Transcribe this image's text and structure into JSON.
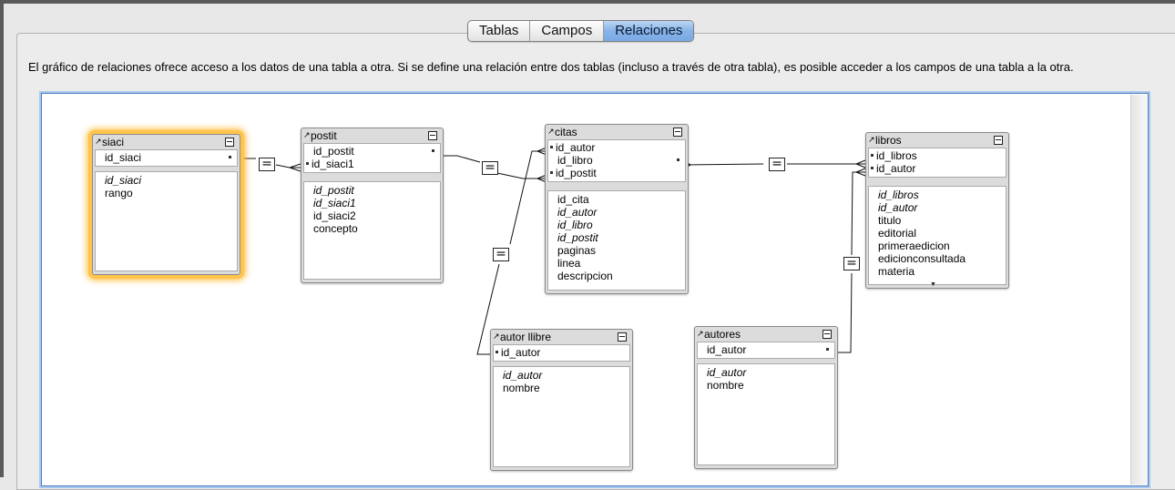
{
  "tabs": [
    {
      "label": "Tablas",
      "selected": false
    },
    {
      "label": "Campos",
      "selected": false
    },
    {
      "label": "Relaciones",
      "selected": true
    }
  ],
  "description": "El gráfico de relaciones ofrece acceso a los datos de una tabla a otra. Si se define una relación entre dos tablas (incluso a través de otra tabla), es posible acceder a los campos de una tabla a la otra.",
  "accent_color": "#87b3e8",
  "highlight_color": "#ffc44a",
  "tables": {
    "siaci": {
      "name": "siaci",
      "keys": [
        "id_siaci"
      ],
      "fields": [
        "id_siaci",
        "rango"
      ]
    },
    "postit": {
      "name": "postit",
      "keys": [
        "id_postit",
        "id_siaci1"
      ],
      "fields": [
        "id_postit",
        "id_siaci1",
        "id_siaci2",
        "concepto"
      ]
    },
    "citas": {
      "name": "citas",
      "keys": [
        "id_autor",
        "id_libro",
        "id_postit"
      ],
      "fields": [
        "id_cita",
        "id_autor",
        "id_libro",
        "id_postit",
        "paginas",
        "linea",
        "descripcion"
      ]
    },
    "libros": {
      "name": "libros",
      "keys": [
        "id_libros",
        "id_autor"
      ],
      "fields": [
        "id_libros",
        "id_autor",
        "titulo",
        "editorial",
        "primeraedicion",
        "edicionconsultada",
        "materia"
      ]
    },
    "autor_llibre": {
      "name": "autor llibre",
      "keys": [
        "id_autor"
      ],
      "fields": [
        "id_autor",
        "nombre"
      ]
    },
    "autores": {
      "name": "autores",
      "keys": [
        "id_autor"
      ],
      "fields": [
        "id_autor",
        "nombre"
      ]
    }
  },
  "relation_operator": "="
}
